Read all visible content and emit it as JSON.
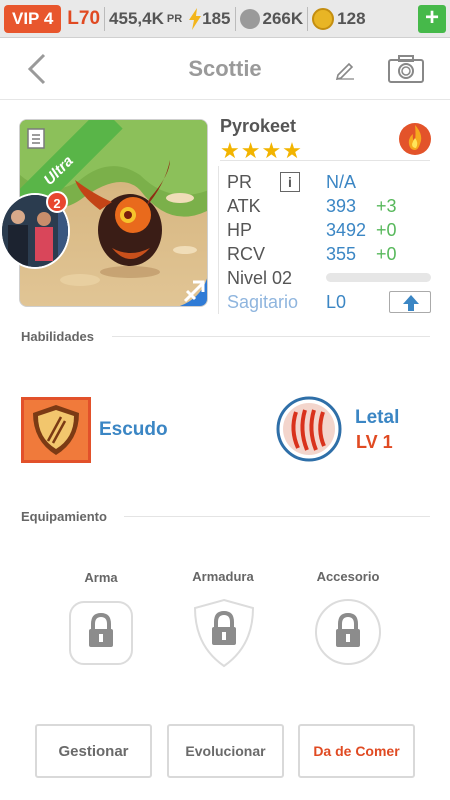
{
  "status_bar": {
    "vip": "VIP 4",
    "level": "L70",
    "power": "455,4K",
    "power_unit": "PR",
    "energy": "185",
    "paws": "266K",
    "coins": "128",
    "plus": "+"
  },
  "header": {
    "back": "<",
    "title": "Scottie"
  },
  "monster": {
    "name": "Pyrokeet",
    "stars": "★★★★",
    "rarity": "Ultra",
    "notification_count": "2",
    "element_color": "#e3532a"
  },
  "stats": {
    "pr_label": "PR",
    "pr_info": "i",
    "pr_value": "N/A",
    "atk_label": "ATK",
    "atk_value": "393",
    "atk_bonus": "+3",
    "hp_label": "HP",
    "hp_value": "3492",
    "hp_bonus": "+0",
    "rcv_label": "RCV",
    "rcv_value": "355",
    "rcv_bonus": "+0",
    "level_label": "Nivel 02",
    "level_progress": 0.0,
    "sign_label": "Sagitario",
    "sign_value": "L0"
  },
  "skills": {
    "section": "Habilidades",
    "skill1": "Escudo",
    "skill2": "Letal",
    "skill2_level": "LV 1"
  },
  "equipment": {
    "section": "Equipamiento",
    "slot1": "Arma",
    "slot2": "Armadura",
    "slot3": "Accesorio"
  },
  "actions": {
    "manage": "Gestionar",
    "evolve": "Evolucionar",
    "feed": "Da de Comer"
  },
  "colors": {
    "accent_blue": "#3b86c4",
    "bonus_green": "#57b85b",
    "orange": "#e04a22",
    "ultra_green": "#59b548"
  }
}
